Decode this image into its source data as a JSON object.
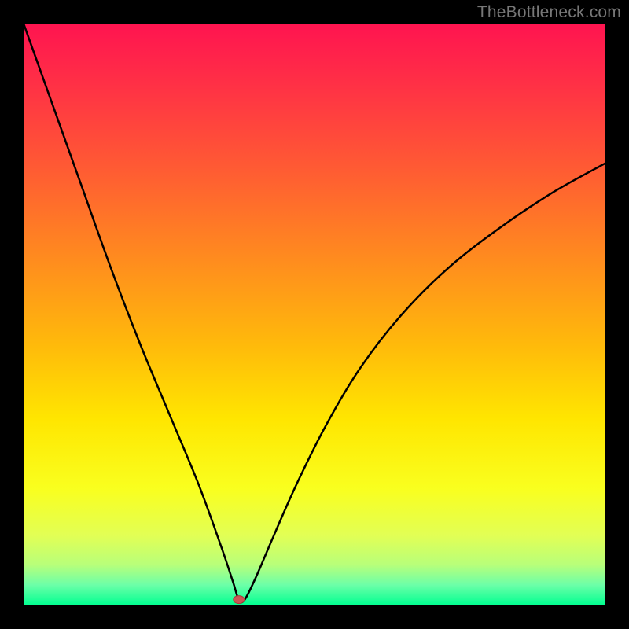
{
  "watermark": "TheBottleneck.com",
  "colors": {
    "frame": "#000000",
    "watermark_text": "#777777",
    "curve": "#000000",
    "marker_fill": "#cc5555",
    "marker_stroke": "#aa3c3c",
    "gradient_stops": [
      {
        "offset": 0.0,
        "color": "#ff1450"
      },
      {
        "offset": 0.1,
        "color": "#ff2f46"
      },
      {
        "offset": 0.25,
        "color": "#ff5b33"
      },
      {
        "offset": 0.4,
        "color": "#ff8a1f"
      },
      {
        "offset": 0.55,
        "color": "#ffb90b"
      },
      {
        "offset": 0.68,
        "color": "#ffe600"
      },
      {
        "offset": 0.8,
        "color": "#f9ff1f"
      },
      {
        "offset": 0.88,
        "color": "#e2ff55"
      },
      {
        "offset": 0.93,
        "color": "#b8ff7a"
      },
      {
        "offset": 0.965,
        "color": "#6cffa8"
      },
      {
        "offset": 1.0,
        "color": "#00ff90"
      }
    ]
  },
  "chart_data": {
    "type": "line",
    "title": "",
    "xlabel": "",
    "ylabel": "",
    "xlim": [
      0,
      100
    ],
    "ylim": [
      0,
      100
    ],
    "grid": false,
    "series": [
      {
        "name": "bottleneck-curve",
        "x": [
          0,
          5,
          10,
          15,
          20,
          25,
          30,
          34,
          36,
          37,
          38,
          40,
          43,
          47,
          52,
          58,
          65,
          73,
          82,
          91,
          100
        ],
        "values": [
          100,
          86,
          72,
          58,
          45,
          33,
          21,
          10,
          4,
          1,
          1,
          5,
          12,
          21,
          31,
          41,
          50,
          58,
          65,
          71,
          76
        ]
      }
    ],
    "annotations": [
      {
        "name": "optimal-marker",
        "x": 37,
        "y": 1
      }
    ]
  }
}
